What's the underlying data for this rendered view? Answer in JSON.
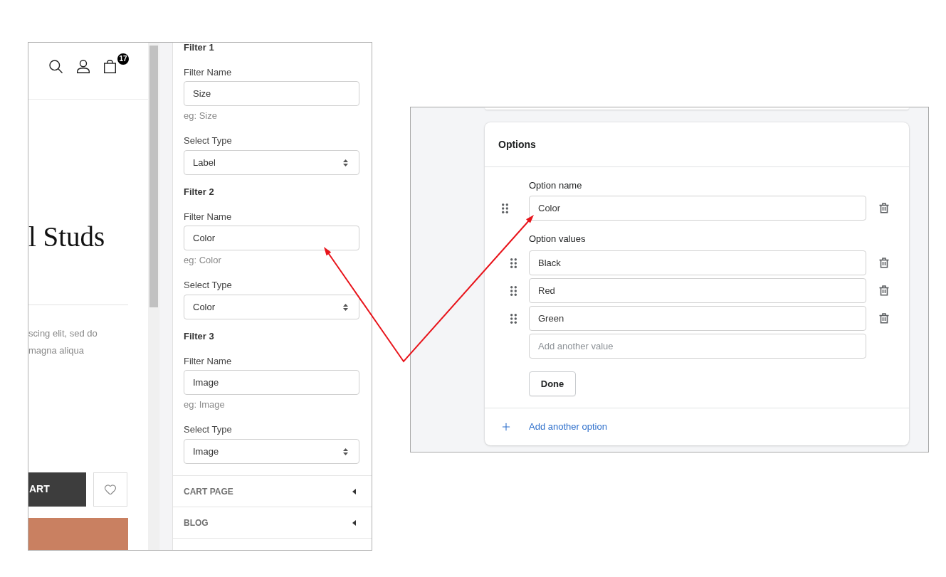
{
  "storefront": {
    "cart_count": "17",
    "product_title": "l Studs",
    "description_lines": [
      "scing elit, sed do",
      "magna aliqua"
    ],
    "add_to_cart_label": "ART"
  },
  "filter_settings": {
    "filters": [
      {
        "heading": "Filter 1",
        "name_label": "Filter Name",
        "name_value": "Size",
        "hint": "eg: Size",
        "type_label": "Select Type",
        "type_value": "Label"
      },
      {
        "heading": "Filter 2",
        "name_label": "Filter Name",
        "name_value": "Color",
        "hint": "eg: Color",
        "type_label": "Select Type",
        "type_value": "Color"
      },
      {
        "heading": "Filter 3",
        "name_label": "Filter Name",
        "name_value": "Image",
        "hint": "eg: Image",
        "type_label": "Select Type",
        "type_value": "Image"
      }
    ],
    "sections": [
      {
        "label": "CART PAGE",
        "expanded": false
      },
      {
        "label": "BLOG",
        "expanded": false
      }
    ]
  },
  "options_card": {
    "title": "Options",
    "option_name_label": "Option name",
    "option_name_value": "Color",
    "option_values_label": "Option values",
    "values": [
      "Black",
      "Red",
      "Green"
    ],
    "new_value_placeholder": "Add another value",
    "done_label": "Done",
    "add_option_label": "Add another option"
  }
}
